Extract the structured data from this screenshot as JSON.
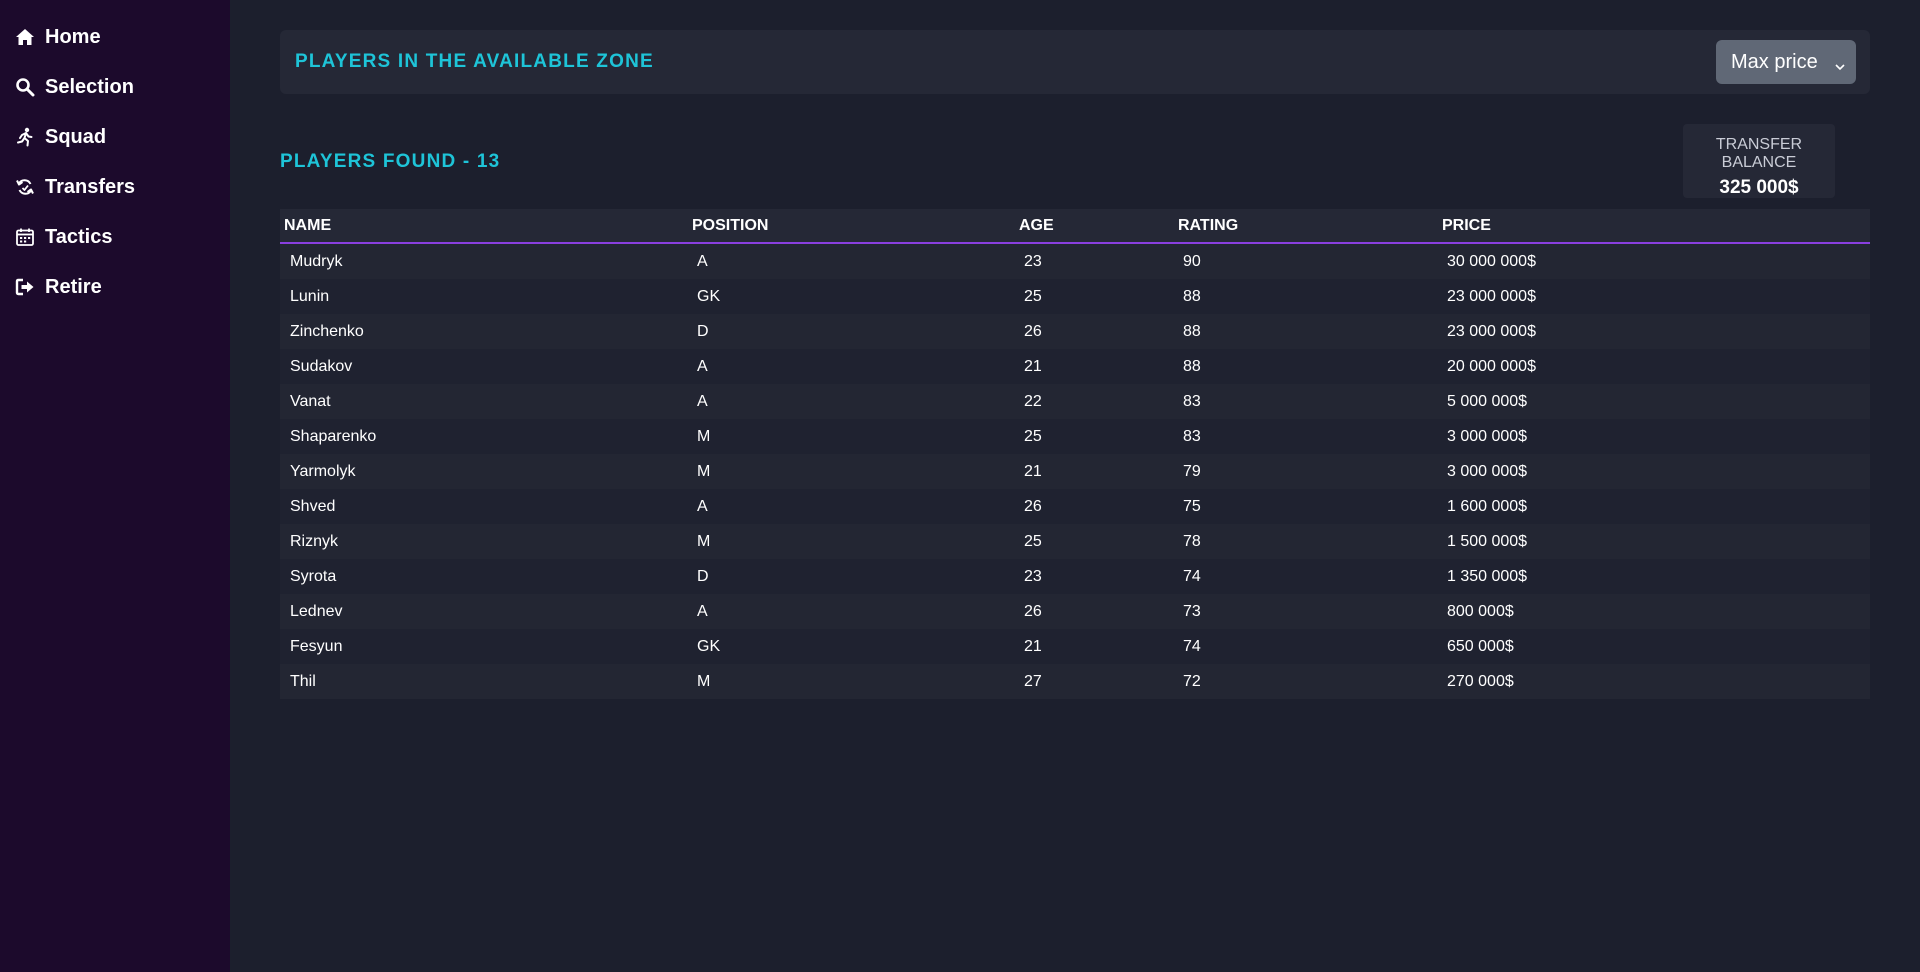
{
  "sidebar": {
    "items": [
      {
        "label": "Home",
        "icon": "home-icon"
      },
      {
        "label": "Selection",
        "icon": "search-icon"
      },
      {
        "label": "Squad",
        "icon": "running-person-icon"
      },
      {
        "label": "Transfers",
        "icon": "transfer-cycle-icon"
      },
      {
        "label": "Tactics",
        "icon": "calendar-icon"
      },
      {
        "label": "Retire",
        "icon": "sign-out-icon"
      }
    ]
  },
  "header": {
    "title": "PLAYERS IN THE AVAILABLE ZONE",
    "sort_label": "Max price"
  },
  "results": {
    "found_label": "PLAYERS FOUND - 13"
  },
  "balance": {
    "label": "TRANSFER BALANCE",
    "value": "325 000$"
  },
  "table": {
    "columns": [
      "NAME",
      "POSITION",
      "AGE",
      "RATING",
      "PRICE"
    ],
    "rows": [
      [
        "Mudryk",
        "A",
        "23",
        "90",
        "30 000 000$"
      ],
      [
        "Lunin",
        "GK",
        "25",
        "88",
        "23 000 000$"
      ],
      [
        "Zinchenko",
        "D",
        "26",
        "88",
        "23 000 000$"
      ],
      [
        "Sudakov",
        "A",
        "21",
        "88",
        "20 000 000$"
      ],
      [
        "Vanat",
        "A",
        "22",
        "83",
        "5 000 000$"
      ],
      [
        "Shaparenko",
        "M",
        "25",
        "83",
        "3 000 000$"
      ],
      [
        "Yarmolyk",
        "M",
        "21",
        "79",
        "3 000 000$"
      ],
      [
        "Shved",
        "A",
        "26",
        "75",
        "1 600 000$"
      ],
      [
        "Riznyk",
        "M",
        "25",
        "78",
        "1 500 000$"
      ],
      [
        "Syrota",
        "D",
        "23",
        "74",
        "1 350 000$"
      ],
      [
        "Lednev",
        "A",
        "26",
        "73",
        "800 000$"
      ],
      [
        "Fesyun",
        "GK",
        "21",
        "74",
        "650 000$"
      ],
      [
        "Thil",
        "M",
        "27",
        "72",
        "270 000$"
      ]
    ]
  },
  "colors": {
    "sidebar_bg": "#1c0a2c",
    "page_bg": "#1c1f2d",
    "accent": "#1ec4d8",
    "header_underline": "#8a3fe0"
  }
}
